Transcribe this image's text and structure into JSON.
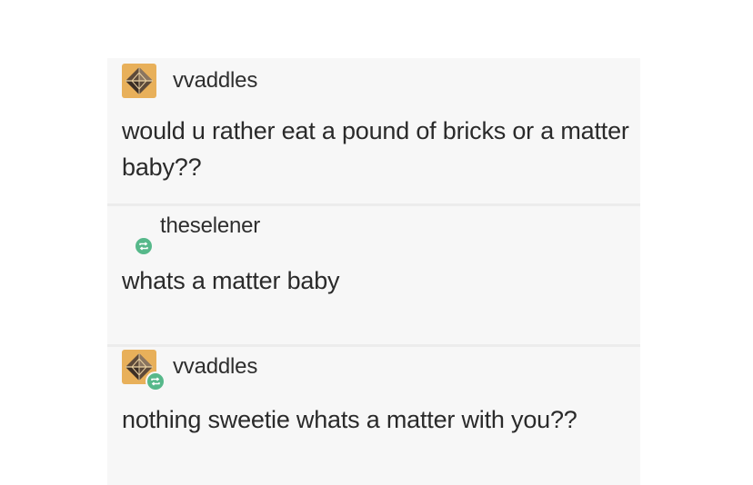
{
  "thread": {
    "posts": [
      {
        "username": "vvaddles",
        "avatar_icon": "diamond-avatar-icon",
        "reblog": false,
        "text": "would u rather eat a pound of bricks or a matter baby??"
      },
      {
        "username": "theselener",
        "avatar_icon": "reblog-icon",
        "reblog": true,
        "text": "whats a matter baby"
      },
      {
        "username": "vvaddles",
        "avatar_icon": "diamond-avatar-icon",
        "reblog": true,
        "text": "nothing sweetie whats a matter with you??"
      }
    ]
  },
  "colors": {
    "avatar_bg": "#e8b05a",
    "reblog_green": "#56b88a",
    "card_bg": "#f7f7f7"
  }
}
